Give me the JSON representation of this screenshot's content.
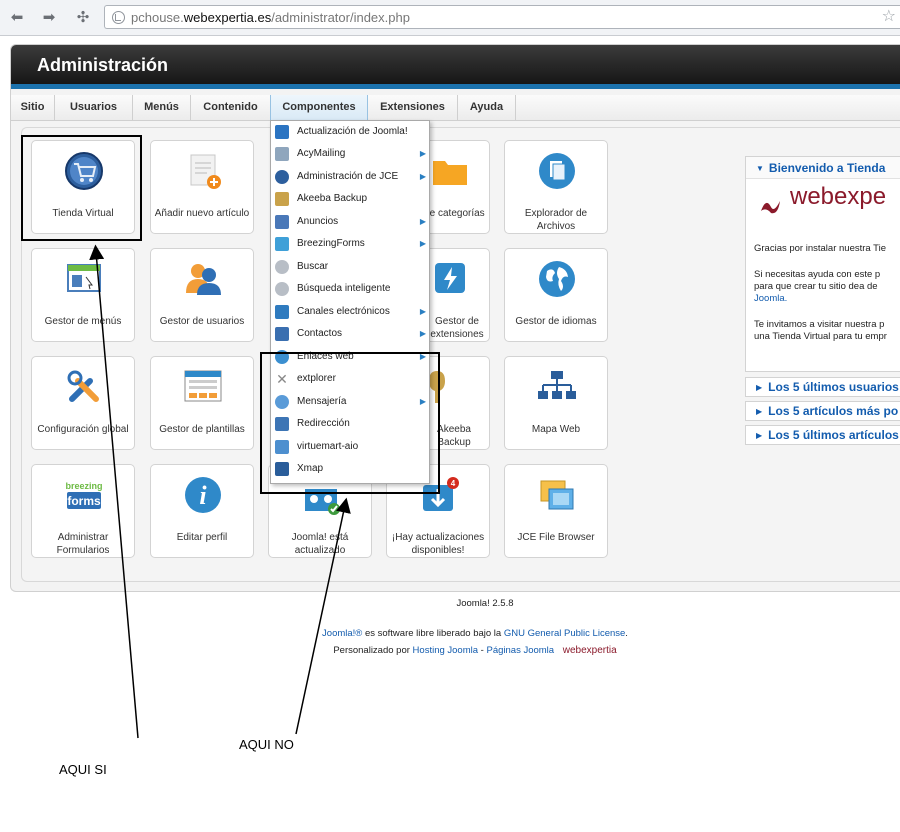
{
  "browser": {
    "url_prefix": "pchouse.",
    "url_domain": "webexpertia.es",
    "url_path": "/administrator/index.php",
    "back_icon": "back-arrow-icon",
    "forward_icon": "forward-arrow-icon",
    "reload_icon": "extensions-icon",
    "star_icon": "bookmark-star-icon"
  },
  "header": {
    "title": "Administración"
  },
  "menu": [
    {
      "label": "Sitio"
    },
    {
      "label": "Usuarios"
    },
    {
      "label": "Menús"
    },
    {
      "label": "Contenido"
    },
    {
      "label": "Componentes",
      "active": true
    },
    {
      "label": "Extensiones"
    },
    {
      "label": "Ayuda"
    }
  ],
  "quickicons": [
    {
      "label": "Tienda Virtual",
      "icon": "cart-icon"
    },
    {
      "label": "Añadir nuevo artículo",
      "icon": "new-article-icon"
    },
    {
      "label": "Gestor de categorías",
      "icon": "folder-icon"
    },
    {
      "label": "Explorador de Archivos",
      "icon": "files-icon"
    },
    {
      "label": "Gestor de menús",
      "icon": "menu-icon"
    },
    {
      "label": "Gestor de usuarios",
      "icon": "users-icon"
    },
    {
      "label": "Gestor de extensiones",
      "icon": "extensions-icon"
    },
    {
      "label": "Gestor de idiomas",
      "icon": "globe-icon"
    },
    {
      "label": "Configuración global",
      "icon": "tools-icon"
    },
    {
      "label": "Gestor de plantillas",
      "icon": "template-icon"
    },
    {
      "label": "",
      "icon": "blank-icon"
    },
    {
      "label": "Akeeba Backup",
      "icon": "backup-icon"
    },
    {
      "label": "Mapa Web",
      "icon": "sitemap-icon"
    },
    {
      "label": "Administrar Formularios",
      "icon": "breezing-forms-icon"
    },
    {
      "label": "Editar perfil",
      "icon": "info-icon"
    },
    {
      "label": "Joomla! está actualizado",
      "icon": "joomla-icon"
    },
    {
      "label": "¡Hay actualizaciones disponibles!",
      "icon": "update-icon"
    },
    {
      "label": "JCE File Browser",
      "icon": "file-browser-icon"
    }
  ],
  "dropdown": [
    {
      "label": "Actualización de Joomla!",
      "sub": false,
      "color": "#2b74c2"
    },
    {
      "label": "AcyMailing",
      "sub": true,
      "color": "#8fa6bd"
    },
    {
      "label": "Administración de JCE",
      "sub": true,
      "color": "#2d5f9e"
    },
    {
      "label": "Akeeba Backup",
      "sub": false,
      "color": "#c9a24a"
    },
    {
      "label": "Anuncios",
      "sub": true,
      "color": "#4a78b8"
    },
    {
      "label": "BreezingForms",
      "sub": true,
      "color": "#3fa0d8"
    },
    {
      "label": "Buscar",
      "sub": false,
      "color": "#b8bec6"
    },
    {
      "label": "Búsqueda inteligente",
      "sub": false,
      "color": "#b8bec6"
    },
    {
      "label": "Canales electrónicos",
      "sub": true,
      "color": "#2f7bbf"
    },
    {
      "label": "Contactos",
      "sub": true,
      "color": "#3a6fb0"
    },
    {
      "label": "Enlaces web",
      "sub": true,
      "color": "#3b8fd0"
    },
    {
      "label": "extplorer",
      "sub": false,
      "color": "#888888"
    },
    {
      "label": "Mensajería",
      "sub": true,
      "color": "#5a9bd8"
    },
    {
      "label": "Redirección",
      "sub": false,
      "color": "#3d75b5"
    },
    {
      "label": "virtuemart-aio",
      "sub": false,
      "color": "#4d8fcf"
    },
    {
      "label": "Xmap",
      "sub": false,
      "color": "#2a5d9a"
    }
  ],
  "welcome": {
    "title": "Bienvenido a Tienda",
    "logo_text": "webexpe",
    "p1": "Gracias por instalar nuestra Tie",
    "p2a": "Si necesitas ayuda con este p",
    "p2b": "para que crear tu sitio dea de",
    "p2c": "Joomla.",
    "p3a": "Te invitamos a visitar nuestra p",
    "p3b": "una Tienda Virtual para tu empr"
  },
  "collapsed": [
    {
      "label": "Los 5 últimos usuarios"
    },
    {
      "label": "Los 5 artículos más po"
    },
    {
      "label": "Los 5 últimos artículos"
    }
  ],
  "footer": {
    "version": "Joomla! 2.5.8",
    "l1_link1": "Joomla!®",
    "l1_text": " es software libre liberado bajo la ",
    "l1_link2": "GNU General Public License",
    "l1_end": ".",
    "l2_text": "Personalizado por ",
    "l2_link1": "Hosting Joomla",
    "l2_sep": " - ",
    "l2_link2": "Páginas Joomla",
    "l2_logo": "webexpertia"
  },
  "annotations": {
    "aqui_si": "AQUI SI",
    "aqui_no": "AQUI NO"
  },
  "colors": {
    "accent": "#1b72ad",
    "link": "#135cae",
    "brand_red": "#8b1a2b"
  }
}
